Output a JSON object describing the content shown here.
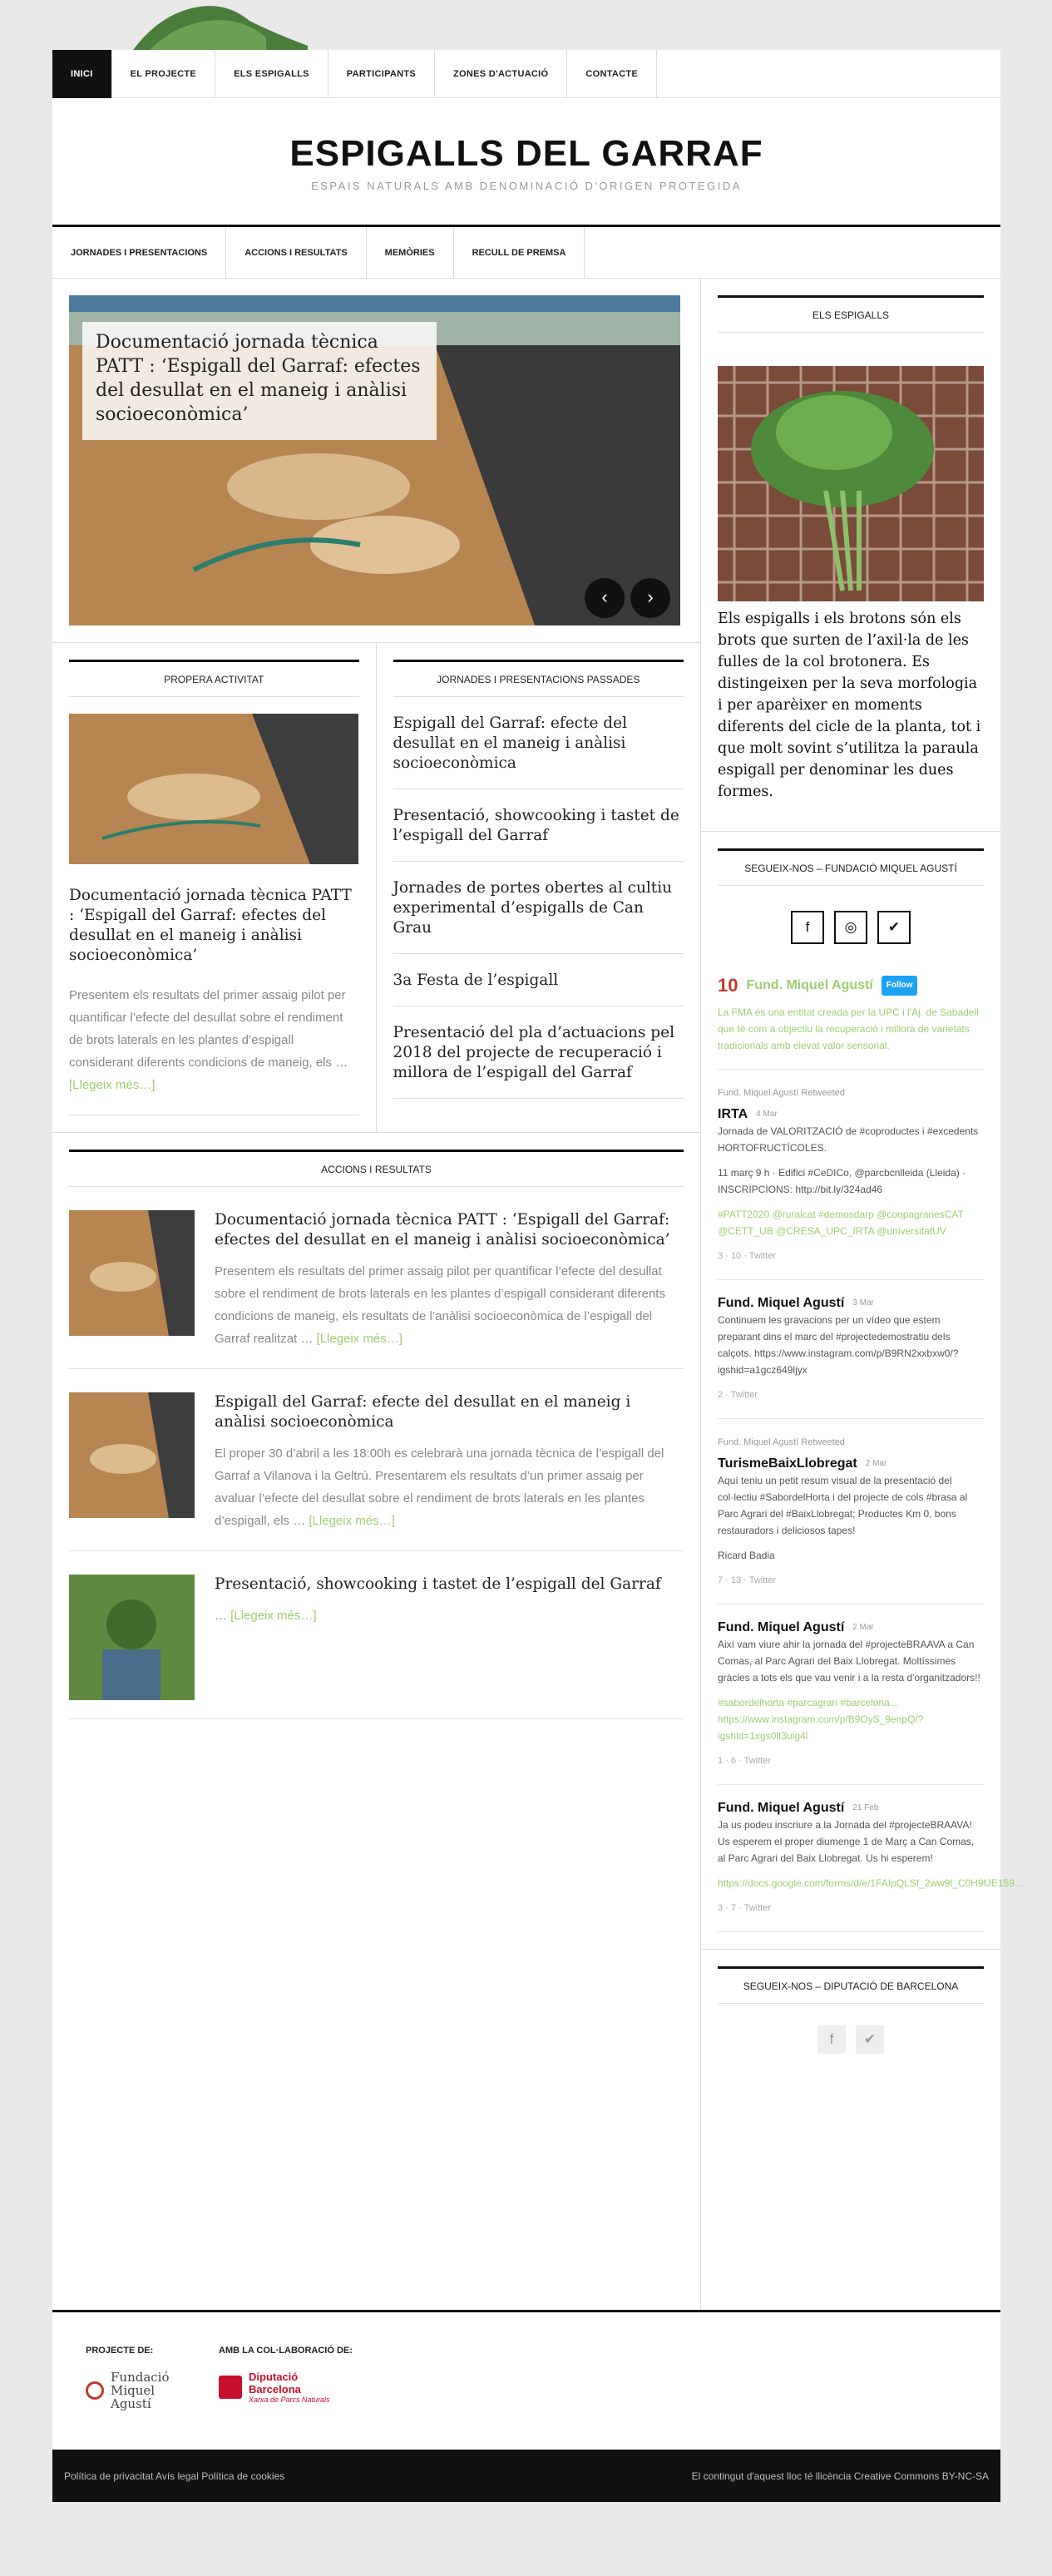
{
  "topnav": [
    "INICI",
    "EL PROJECTE",
    "ELS ESPIGALLS",
    "PARTICIPANTS",
    "ZONES D'ACTUACIÓ",
    "CONTACTE"
  ],
  "site": {
    "title": "ESPIGALLS DEL GARRAF",
    "description": "ESPAIS NATURALS AMB DENOMINACIÓ D'ORIGEN PROTEGIDA"
  },
  "secnav": [
    "JORNADES I PRESENTACIONS",
    "ACCIONS I RESULTATS",
    "MEMÒRIES",
    "RECULL DE PREMSA"
  ],
  "slider": {
    "caption": "Documentació jornada tècnica PATT : ‘Espigall del Garraf: efectes del desullat en el maneig i anàlisi socioeconòmica’",
    "prev": "‹",
    "next": "›"
  },
  "propera": {
    "heading": "PROPERA ACTIVITAT",
    "title": "Documentació jornada tècnica PATT : ‘Espigall del Garraf: efectes del desullat en el maneig i anàlisi socioeconòmica’",
    "excerpt": "Presentem els resultats del primer assaig pilot per quantificar l’efecte del desullat sobre el rendiment de brots laterals en les plantes d’espigall considerant diferents condicions de maneig, els …",
    "more": "[Llegeix més…]"
  },
  "passades": {
    "heading": "JORNADES I PRESENTACIONS PASSADES",
    "items": [
      "Espigall del Garraf: efecte del desullat en el maneig i anàlisi socioeconòmica",
      "Presentació, showcooking i tastet de l’espigall del Garraf",
      "Jornades de portes obertes al cultiu experimental d’espigalls de Can Grau",
      "3a Festa de l’espigall",
      "Presentació del pla d’actuacions pel 2018 del projecte de recuperació i millora de l’espigall del Garraf"
    ]
  },
  "accions": {
    "heading": "ACCIONS I RESULTATS",
    "items": [
      {
        "title": "Documentació jornada tècnica PATT : ‘Espigall del Garraf: efectes del desullat en el maneig i anàlisi socioeconòmica’",
        "excerpt": "Presentem els resultats del primer assaig pilot per quantificar l’efecte del desullat sobre el rendiment de brots laterals en les plantes d’espigall considerant diferents condicions de maneig, els resultats de l’anàlisi socioeconòmica de l’espigall del Garraf realitzat …",
        "more": "[Llegeix més…]"
      },
      {
        "title": "Espigall del Garraf: efecte del desullat en el maneig i anàlisi socioeconòmica",
        "excerpt": "El proper 30 d’abril a les 18:00h es celebrarà una jornada tècnica de l’espigall del Garraf a Vilanova i la Geltrú. Presentarem els resultats d’un primer assaig per avaluar l’efecte del desullat sobre el rendiment de brots laterals en les plantes d’espigall, els …",
        "more": "[Llegeix més…]"
      },
      {
        "title": "Presentació, showcooking i tastet de l’espigall del Garraf",
        "excerpt": "…",
        "more": "[Llegeix més…]"
      }
    ]
  },
  "sidebar": {
    "espigalls_heading": "ELS ESPIGALLS",
    "espigalls_text": "Els espigalls i els brotons són els brots que surten de l’axil·la de les fulles de la col brotonera. Es distingeixen per la seva morfologia i per aparèixer en moments diferents del cicle de la planta, tot i que molt sovint s’utilitza la paraula espigall per denominar les dues formes.",
    "segueix_heading": "SEGUEIX-NOS – FUNDACIÓ MIQUEL AGUSTÍ",
    "social_icons": [
      "f",
      "◎",
      "✔"
    ],
    "twitter_account": "Fund. Miquel Agustí",
    "follow": "Follow",
    "bio": "La FMA és una entitat creada per la UPC i l'Aj. de Sabadell que té com a objectiu la recuperació i millora de varietats tradicionals amb elevat valor sensorial.",
    "tweets": [
      {
        "retweet": "Fund. Miquel Agustí Retweeted",
        "user": "IRTA",
        "date": "4 Mar",
        "text": "Jornada de VALORITZACIÓ de #coproductes i #excedents HORTOFRUCTÍCOLES.",
        "text2": "11 març 9 h · Edifici #CeDICo, @parcbcnlleida (Lleida) · INSCRIPCIONS: http://bit.ly/324ad46",
        "tags": "#PATT2020 @ruralcat #demosdarp @coopagrariesCAT @CETT_UB @CRESA_UPC_IRTA @universitatUV",
        "counts": "3 · 10 · Twitter"
      },
      {
        "retweet": "",
        "user": "Fund. Miquel Agustí",
        "date": "3 Mar",
        "text": "Continuem les gravacions per un vídeo que estem preparant dins el marc del #projectedemostratiu dels calçots. https://www.instagram.com/p/B9RN2xxbxw0/?igshid=a1gcz649ljyx",
        "text2": "",
        "tags": "",
        "counts": "2 · Twitter"
      },
      {
        "retweet": "Fund. Miquel Agustí Retweeted",
        "user": "TurismeBaixLlobregat",
        "date": "2 Mar",
        "text": "Aquí teniu un petit resum visual de la presentació del col·lectiu #SabordelHorta i del projecte de cols #brasa al Parc Agrari del #BaixLlobregat; Productes Km 0, bons restauradors i deliciosos tapes!",
        "text2": "Ricard Badia",
        "tags": "",
        "counts": "7 · 13 · Twitter"
      },
      {
        "retweet": "",
        "user": "Fund. Miquel Agustí",
        "date": "2 Mar",
        "text": "Així vam viure ahir la jornada del #projecteBRAAVA a Can Comas, al Parc Agrari del Baix Llobregat. Moltíssimes gràcies a tots els que vau venir i a la resta d'organitzadors!!",
        "text2": "",
        "tags": "#sabordelhorta #parcagrari #barcelona… https://www.instagram.com/p/B9OyS_9enpQ/?igshid=1xgs0lt3uig4l",
        "counts": "1 · 6 · Twitter"
      },
      {
        "retweet": "",
        "user": "Fund. Miquel Agustí",
        "date": "21 Feb",
        "text": "Ja us podeu inscriure a la Jornada del #projecteBRAAVA! Us esperem el proper diumenge 1 de Març a Can Comas, al Parc Agrari del Baix Llobregat. Us hi esperem!",
        "text2": "",
        "tags": "https://docs.google.com/forms/d/e/1FAIpQLSf_2ww9l_C0H9fJE159…",
        "counts": "3 · 7 · Twitter"
      }
    ],
    "diputacio_heading": "SEGUEIX-NOS – DIPUTACIÓ DE BARCELONA",
    "diputacio_icons": [
      "f",
      "✔"
    ]
  },
  "footer": {
    "projecte_de": "PROJECTE DE:",
    "amb_colaboracio": "AMB LA COL·LABORACIÓ DE:",
    "fundacio": "Fundació Miquel Agustí",
    "diputacio": "Diputació Barcelona",
    "xarxa": "Xarxa de Parcs Naturals",
    "links": "Política de privacitat  Avís legal  Política de cookies",
    "license": "El contingut d'aquest lloc té llicència Creative Commons BY-NC-SA"
  },
  "colors": {
    "accent": "#9ccf6e",
    "dark": "#111111",
    "twitter": "#1da1f2"
  }
}
